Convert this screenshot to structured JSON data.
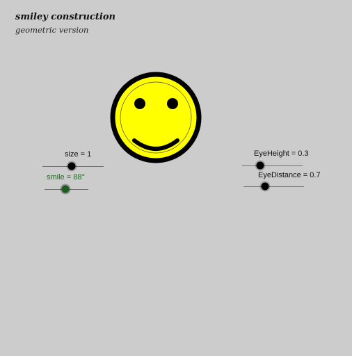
{
  "header": {
    "title": "smiley construction",
    "subtitle": "geometric version"
  },
  "sliders": {
    "size": {
      "label": "size = 1",
      "value": 1
    },
    "smile": {
      "label": "smile = 88°",
      "value": 88
    },
    "eye_height": {
      "label": "EyeHeight = 0.3",
      "value": 0.3
    },
    "eye_distance": {
      "label": "EyeDistance = 0.7",
      "value": 0.7
    }
  },
  "colors": {
    "background": "#cccccc",
    "face_fill": "#ffff00",
    "face_outline": "#000000",
    "smile_slider": "#1b5e20"
  }
}
